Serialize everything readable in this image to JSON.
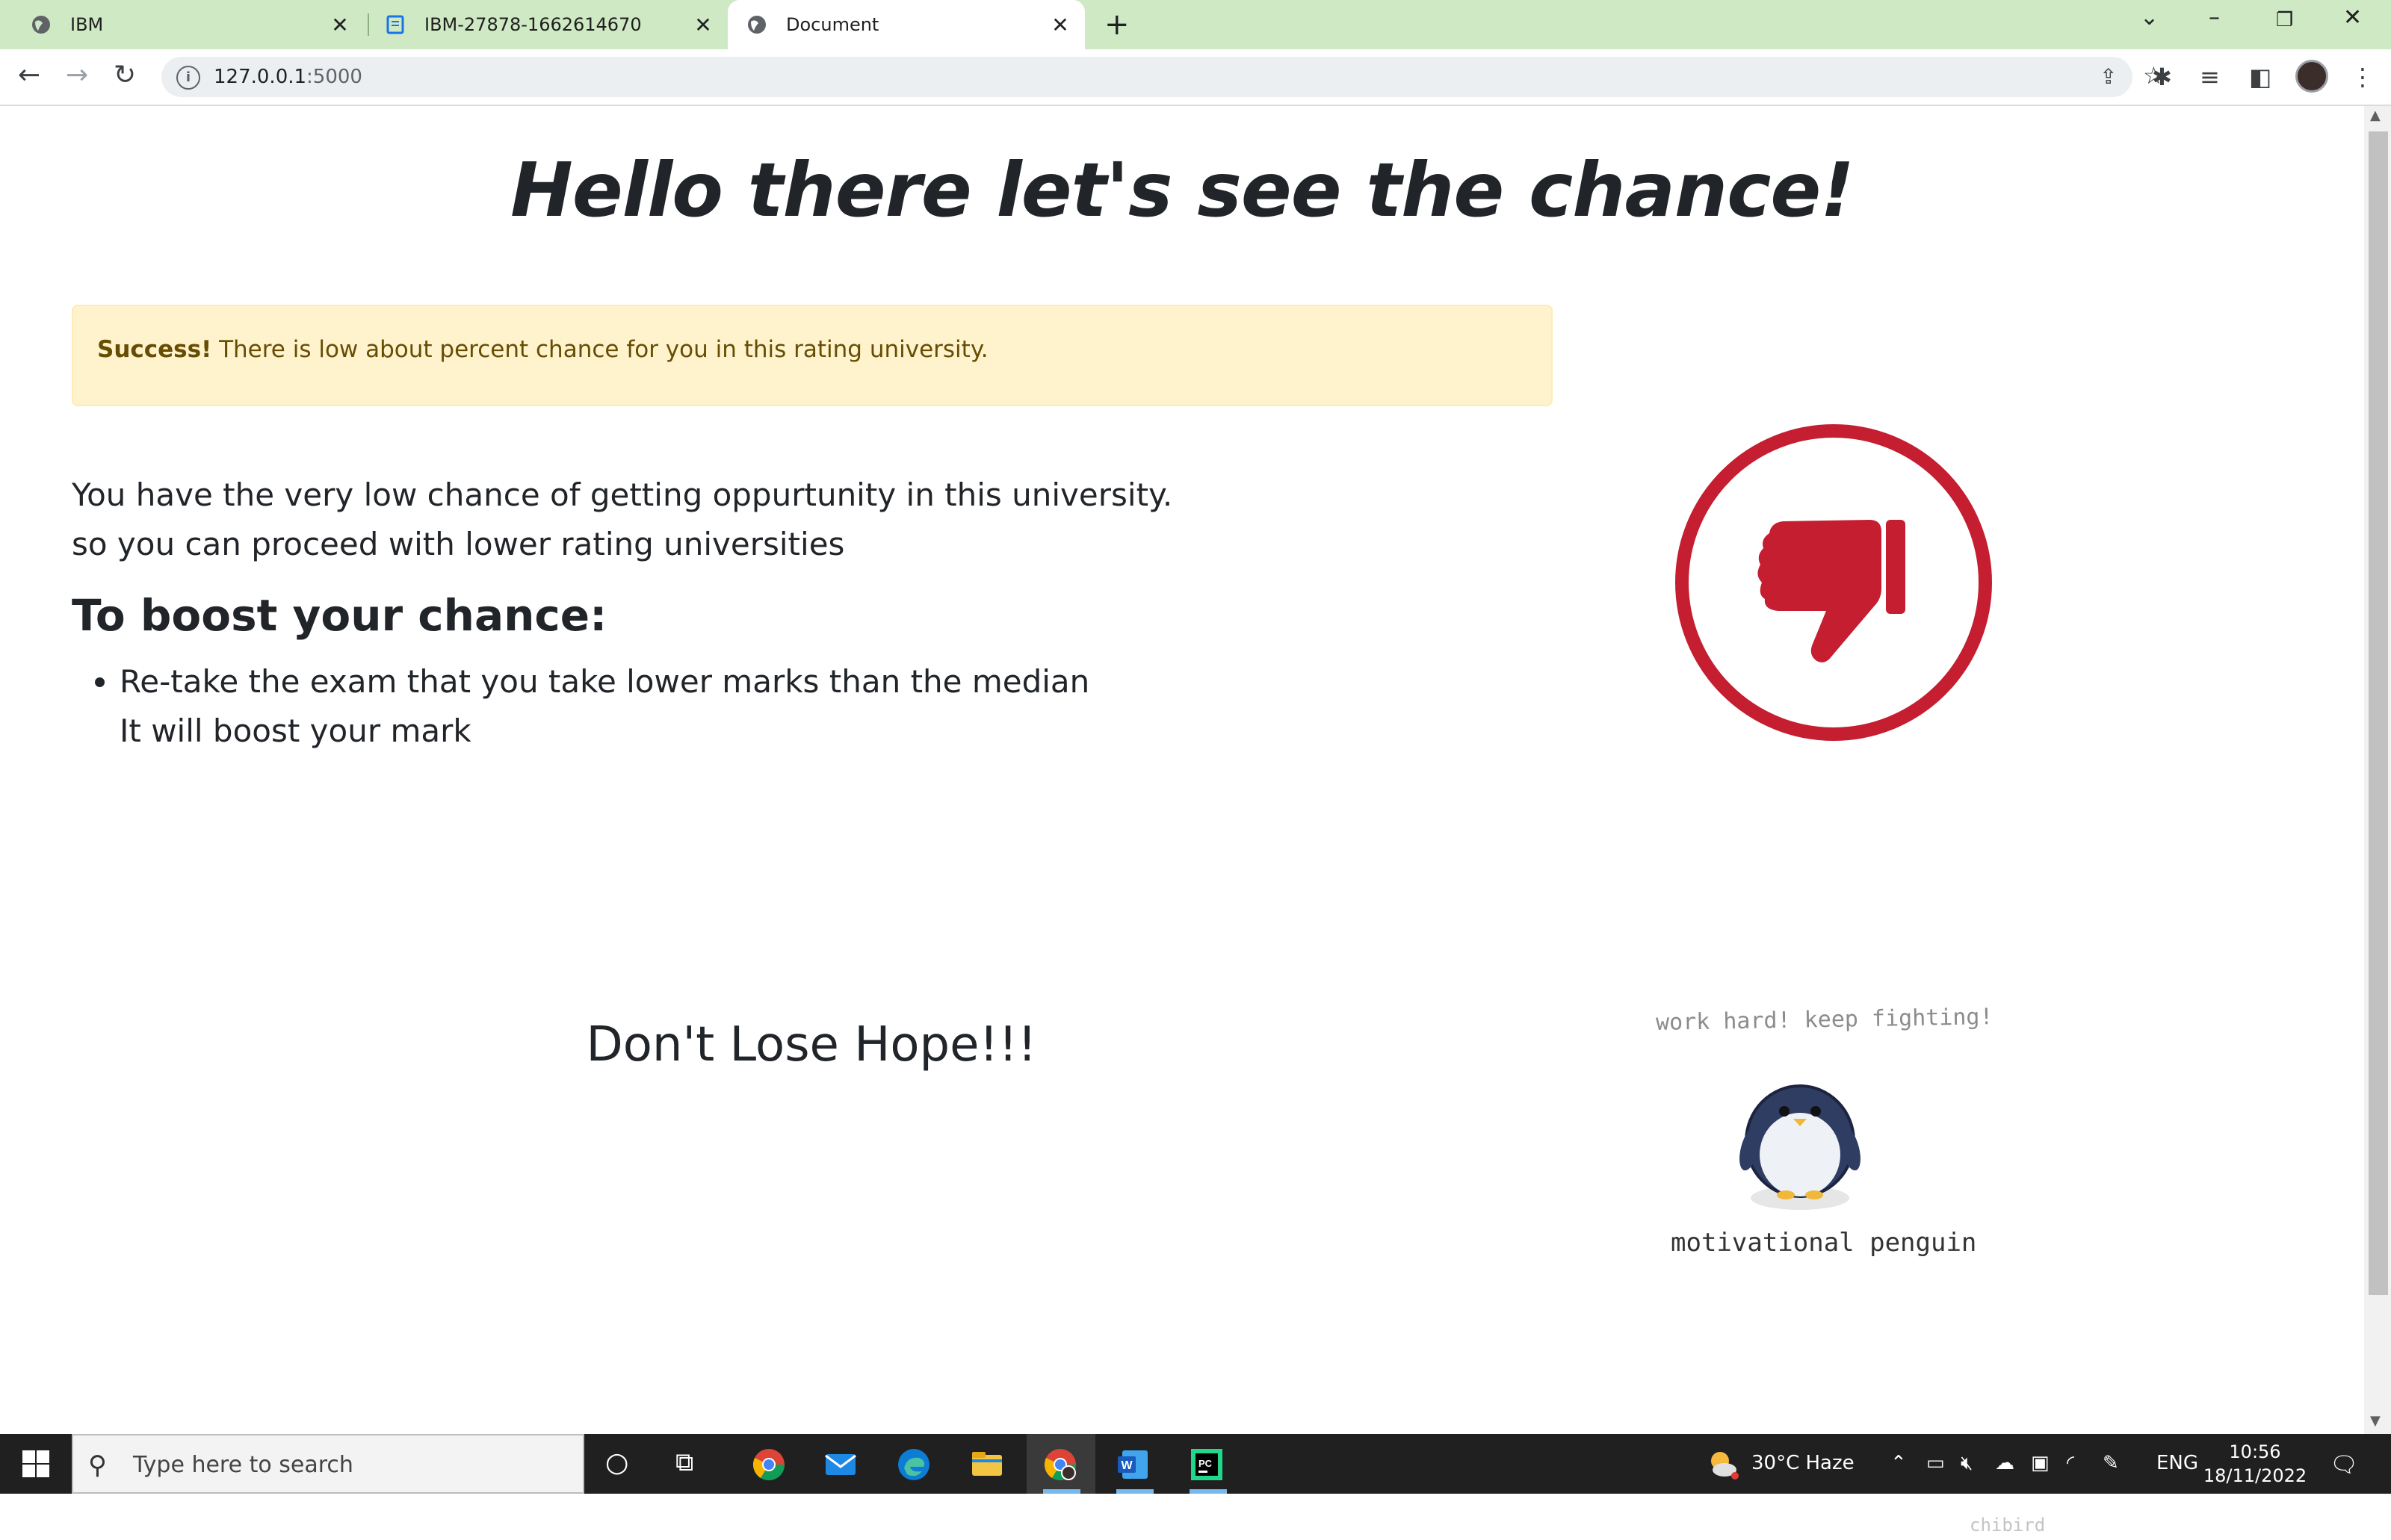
{
  "browser": {
    "tabs": [
      {
        "title": "IBM",
        "icon": "globe-icon"
      },
      {
        "title": "IBM-27878-1662614670",
        "icon": "doc-icon"
      },
      {
        "title": "Document",
        "icon": "globe-icon",
        "active": true
      }
    ],
    "url": {
      "host": "127.0.0.1",
      "port": ":5000"
    }
  },
  "page": {
    "heading": "Hello there let's see the chance!",
    "alert": {
      "strong": "Success!",
      "text": " There is low about percent chance for you in this rating university."
    },
    "description_line1": "You have the very low chance of getting oppurtunity in this university.",
    "description_line2": "so you can proceed with lower rating universities",
    "boost_heading": "To boost your chance:",
    "tips": [
      {
        "line1": "Re-take the exam that you take lower marks than the median",
        "line2": "It will boost your mark"
      }
    ],
    "hope": "Don't Lose Hope!!!",
    "penguin": {
      "top_text": "work hard! keep fighting!",
      "caption": "motivational penguin",
      "signature": "chibird"
    }
  },
  "taskbar": {
    "search_placeholder": "Type here to search",
    "weather": "30°C  Haze",
    "lang": "ENG",
    "time": "10:56",
    "date": "18/11/2022"
  },
  "colors": {
    "tab_strip": "#cfe9c4",
    "alert_bg": "#fff3cd",
    "alert_text": "#664d03",
    "thumbs_red": "#c41e30"
  }
}
